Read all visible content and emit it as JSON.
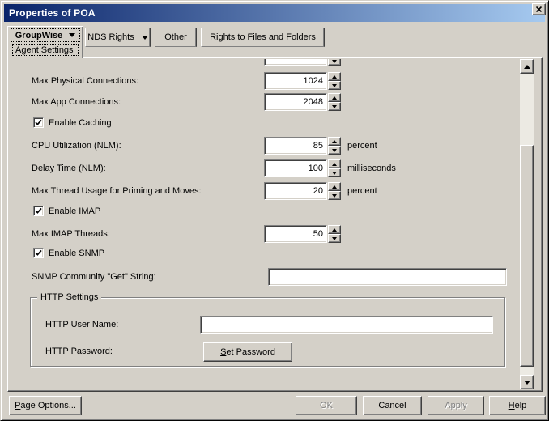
{
  "window": {
    "title": "Properties of POA"
  },
  "icons": {
    "close": "x-close",
    "tab_dropdown": "triangle-down",
    "spin_up": "triangle-up",
    "spin_down": "triangle-down",
    "checkbox_check": "checkmark"
  },
  "tabs": {
    "groupwise": {
      "label": "GroupWise",
      "page": "Agent Settings"
    },
    "nds": {
      "label": "NDS Rights"
    },
    "other": {
      "label": "Other"
    },
    "rights": {
      "label": "Rights to Files and Folders"
    }
  },
  "fields": {
    "partial_top": {
      "value": ""
    },
    "max_physical": {
      "label": "Max Physical Connections:",
      "value": "1024"
    },
    "max_app": {
      "label": "Max App Connections:",
      "value": "2048"
    },
    "enable_caching": {
      "label": "Enable Caching",
      "checked": true
    },
    "cpu_util": {
      "label": "CPU Utilization (NLM):",
      "value": "85",
      "unit": "percent"
    },
    "delay_time": {
      "label": "Delay Time (NLM):",
      "value": "100",
      "unit": "milliseconds"
    },
    "max_thread": {
      "label": "Max Thread Usage for Priming and Moves:",
      "value": "20",
      "unit": "percent"
    },
    "enable_imap": {
      "label": "Enable IMAP",
      "checked": true
    },
    "max_imap": {
      "label": "Max IMAP Threads:",
      "value": "50"
    },
    "enable_snmp": {
      "label": "Enable SNMP",
      "checked": true
    },
    "snmp_get": {
      "label": "SNMP Community \"Get\" String:",
      "value": ""
    },
    "http_group": {
      "title": "HTTP Settings",
      "user_name": {
        "label": "HTTP User Name:",
        "value": ""
      },
      "password": {
        "label": "HTTP Password:",
        "button_u": "S",
        "button_rest": "et Password"
      }
    }
  },
  "buttons": {
    "page_options": {
      "u": "P",
      "rest": "age Options..."
    },
    "ok": "OK",
    "cancel": "Cancel",
    "apply": "Apply",
    "help": {
      "u": "H",
      "rest": "elp"
    }
  },
  "colors": {
    "titlebar_from": "#0A246A",
    "titlebar_to": "#A6CAF0",
    "face": "#D4D0C8",
    "disabled_text": "#808080"
  }
}
